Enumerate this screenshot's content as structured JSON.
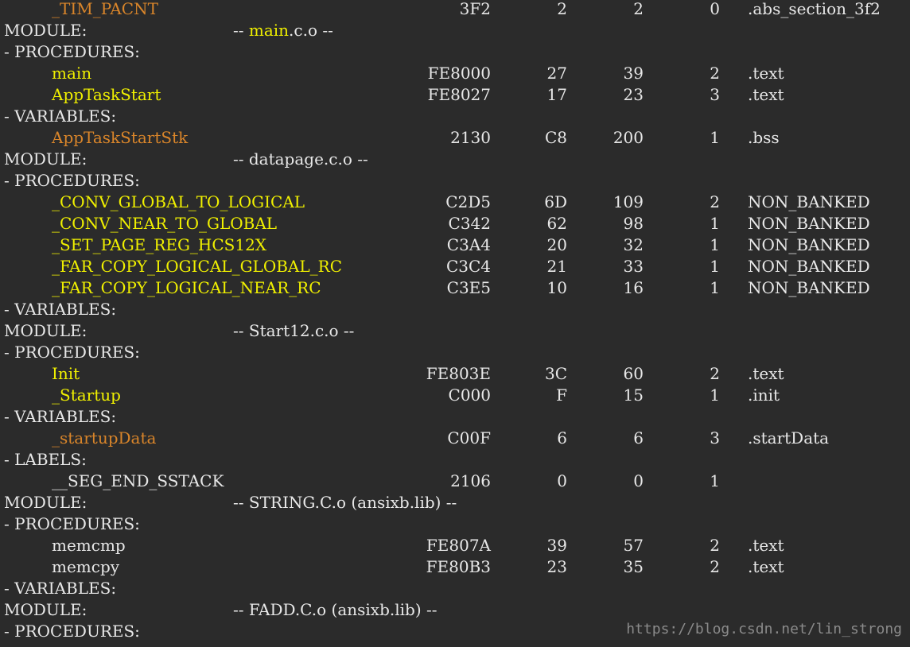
{
  "lines": [
    {
      "type": "entry",
      "name": "_TIM_PACNT",
      "name_color": "orange",
      "addr": "3F2",
      "hex": "2",
      "dec": "2",
      "refs": "0",
      "section": ".abs_section_3f2"
    },
    {
      "type": "module",
      "label": "MODULE:",
      "name_prefix": "-- ",
      "name_main": "main",
      "name_rest": ".c.o --"
    },
    {
      "type": "header",
      "text": "- PROCEDURES:"
    },
    {
      "type": "entry",
      "name": "main",
      "name_color": "yellow",
      "addr": "FE8000",
      "hex": "27",
      "dec": "39",
      "refs": "2",
      "section": ".text"
    },
    {
      "type": "entry",
      "name": "AppTaskStart",
      "name_color": "yellow",
      "addr": "FE8027",
      "hex": "17",
      "dec": "23",
      "refs": "3",
      "section": ".text"
    },
    {
      "type": "header",
      "text": "- VARIABLES:"
    },
    {
      "type": "entry",
      "name": "AppTaskStartStk",
      "name_color": "orange",
      "addr": "2130",
      "hex": "C8",
      "dec": "200",
      "refs": "1",
      "section": ".bss"
    },
    {
      "type": "module",
      "label": "MODULE:",
      "name_prefix": "",
      "name_main": "",
      "name_rest": "-- datapage.c.o --"
    },
    {
      "type": "header",
      "text": "- PROCEDURES:"
    },
    {
      "type": "entry",
      "name": "_CONV_GLOBAL_TO_LOGICAL",
      "name_color": "yellow",
      "addr": "C2D5",
      "hex": "6D",
      "dec": "109",
      "refs": "2",
      "section": "NON_BANKED"
    },
    {
      "type": "entry",
      "name": "_CONV_NEAR_TO_GLOBAL",
      "name_color": "yellow",
      "addr": "C342",
      "hex": "62",
      "dec": "98",
      "refs": "1",
      "section": "NON_BANKED"
    },
    {
      "type": "entry",
      "name": "_SET_PAGE_REG_HCS12X",
      "name_color": "yellow",
      "addr": "C3A4",
      "hex": "20",
      "dec": "32",
      "refs": "1",
      "section": "NON_BANKED"
    },
    {
      "type": "entry",
      "name": "_FAR_COPY_LOGICAL_GLOBAL_RC",
      "name_color": "yellow",
      "addr": "C3C4",
      "hex": "21",
      "dec": "33",
      "refs": "1",
      "section": "NON_BANKED"
    },
    {
      "type": "entry",
      "name": "_FAR_COPY_LOGICAL_NEAR_RC",
      "name_color": "yellow",
      "addr": "C3E5",
      "hex": "10",
      "dec": "16",
      "refs": "1",
      "section": "NON_BANKED"
    },
    {
      "type": "header",
      "text": "- VARIABLES:"
    },
    {
      "type": "module",
      "label": "MODULE:",
      "name_prefix": "",
      "name_main": "",
      "name_rest": "-- Start12.c.o --"
    },
    {
      "type": "header",
      "text": "- PROCEDURES:"
    },
    {
      "type": "entry",
      "name": "Init",
      "name_color": "yellow",
      "addr": "FE803E",
      "hex": "3C",
      "dec": "60",
      "refs": "2",
      "section": ".text"
    },
    {
      "type": "entry",
      "name": "_Startup",
      "name_color": "yellow",
      "addr": "C000",
      "hex": "F",
      "dec": "15",
      "refs": "1",
      "section": ".init"
    },
    {
      "type": "header",
      "text": "- VARIABLES:"
    },
    {
      "type": "entry",
      "name": "_startupData",
      "name_color": "orange",
      "addr": "C00F",
      "hex": "6",
      "dec": "6",
      "refs": "3",
      "section": ".startData"
    },
    {
      "type": "header",
      "text": "- LABELS:"
    },
    {
      "type": "entry",
      "name": "__SEG_END_SSTACK",
      "name_color": "white",
      "addr": "2106",
      "hex": "0",
      "dec": "0",
      "refs": "1",
      "section": ""
    },
    {
      "type": "module",
      "label": "MODULE:",
      "name_prefix": "",
      "name_main": "",
      "name_rest": "-- STRING.C.o (ansixb.lib) --"
    },
    {
      "type": "header",
      "text": "- PROCEDURES:"
    },
    {
      "type": "entry",
      "name": "memcmp",
      "name_color": "white",
      "addr": "FE807A",
      "hex": "39",
      "dec": "57",
      "refs": "2",
      "section": ".text"
    },
    {
      "type": "entry",
      "name": "memcpy",
      "name_color": "white",
      "addr": "FE80B3",
      "hex": "23",
      "dec": "35",
      "refs": "2",
      "section": ".text"
    },
    {
      "type": "header",
      "text": "- VARIABLES:"
    },
    {
      "type": "module",
      "label": "MODULE:",
      "name_prefix": "",
      "name_main": "",
      "name_rest": "-- FADD.C.o (ansixb.lib) --"
    },
    {
      "type": "header",
      "text": "- PROCEDURES:"
    }
  ],
  "watermark": "https://blog.csdn.net/lin_strong",
  "colors": {
    "background": "#2b2b2b",
    "text": "#e8e8e8",
    "procedure": "#f0f000",
    "variable": "#d9852a"
  }
}
